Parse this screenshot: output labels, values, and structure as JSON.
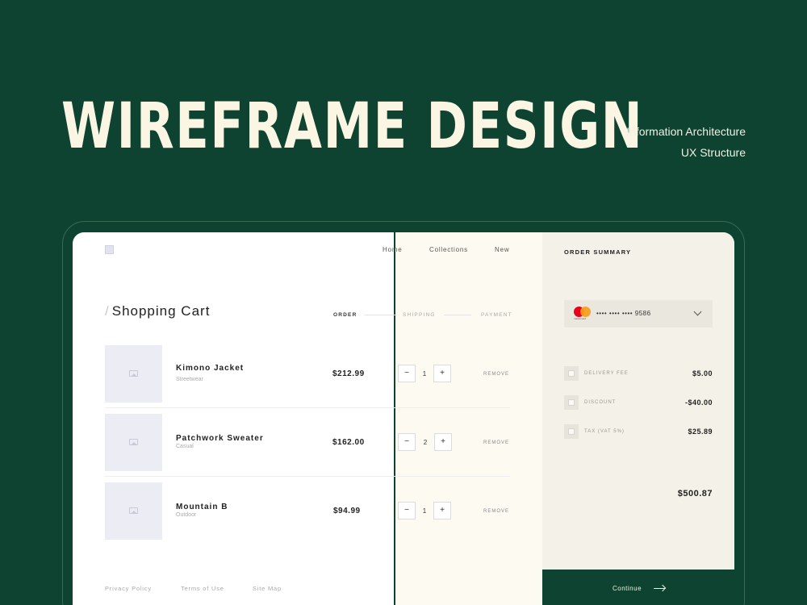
{
  "hero": {
    "title": "WIREFRAME DESIGN",
    "tags": [
      "Information Architecture",
      "UX Structure"
    ]
  },
  "nav": {
    "items": [
      "Home",
      "Collections",
      "New"
    ]
  },
  "page": {
    "title": "Shopping Cart"
  },
  "steps": [
    "ORDER",
    "SHIPPING",
    "PAYMENT"
  ],
  "cart": {
    "items": [
      {
        "name": "Kimono Jacket",
        "category": "Streetwear",
        "price": "$212.99",
        "qty": "1"
      },
      {
        "name": "Patchwork Sweater",
        "category": "Casual",
        "price": "$162.00",
        "qty": "2"
      },
      {
        "name": "Mountain B",
        "category": "Outdoor",
        "price": "$94.99",
        "qty": "1"
      }
    ],
    "remove_label": "REMOVE",
    "minus": "−",
    "plus": "+"
  },
  "footer": {
    "links": [
      "Privacy Policy",
      "Terms of Use",
      "Site Map"
    ]
  },
  "summary": {
    "title": "ORDER SUMMARY",
    "card": {
      "brand_text": "mastercard",
      "number": "•••• •••• •••• 9586",
      "brand_icon": "mastercard-icon"
    },
    "fees": [
      {
        "label": "DELIVERY FEE",
        "value": "$5.00",
        "icon": "delivery-icon"
      },
      {
        "label": "DISCOUNT",
        "value": "-$40.00",
        "icon": "discount-icon"
      },
      {
        "label": "TAX (VAT 5%)",
        "value": "$25.89",
        "icon": "tax-icon"
      }
    ],
    "total": "$500.87",
    "continue_label": "Continue"
  },
  "colors": {
    "brand_green": "#0d4330",
    "hero_text": "#fbf6e4",
    "cream": "#fdfaf2",
    "summary_bg": "#f4f1e8"
  }
}
